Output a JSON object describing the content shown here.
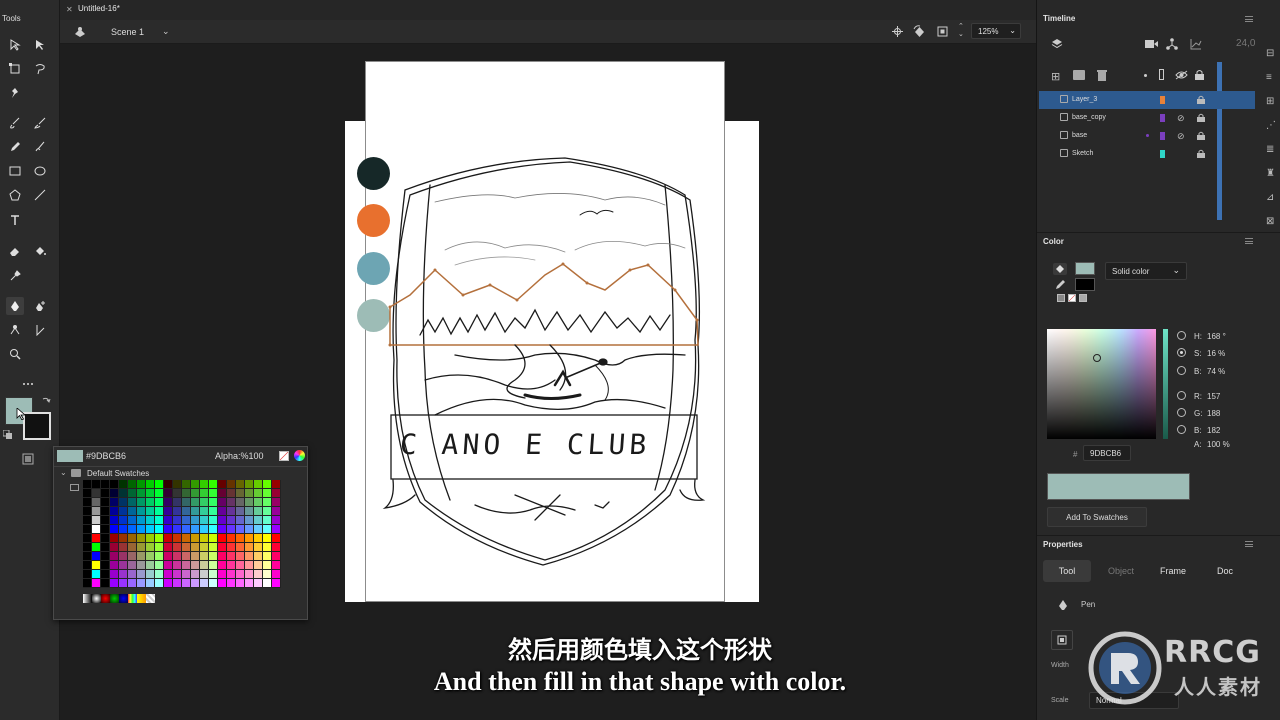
{
  "tools_panel": {
    "title": "Tools"
  },
  "document": {
    "tab_title": "Untitled-16*",
    "scene": "Scene 1",
    "zoom": "125%"
  },
  "palette_swatches": [
    "#162828",
    "#E8702E",
    "#6DA5B3",
    "#9DBCB6"
  ],
  "canvas_text": "C ANO E CLUB",
  "swatch_popup": {
    "hex": "#9DBCB6",
    "alpha": "Alpha:%100",
    "folder": "Default Swatches"
  },
  "timeline": {
    "title": "Timeline",
    "frame_number": "24,0",
    "layers": [
      {
        "name": "Layer_3",
        "color": "#E8823A",
        "selected": true
      },
      {
        "name": "base_copy",
        "color": "#7B3FBF",
        "selected": false
      },
      {
        "name": "base",
        "color": "#7B3FBF",
        "selected": false
      },
      {
        "name": "Sketch",
        "color": "#2FD6C8",
        "selected": false
      }
    ]
  },
  "color_panel": {
    "title": "Color",
    "fill_type": "Solid color",
    "fill_color": "#9DBCB6",
    "stroke_color": "#000000",
    "h_label": "H:",
    "h_value": "168 °",
    "s_label": "S:",
    "s_value": "16 %",
    "b_label": "B:",
    "b_value": "74 %",
    "r_label": "R:",
    "r_value": "157",
    "g_label": "G:",
    "g_value": "188",
    "b2_label": "B:",
    "b2_value": "182",
    "a_label": "A:",
    "a_value": "100 %",
    "hash": "#",
    "hex": "9DBCB6",
    "add_button": "Add To Swatches"
  },
  "properties": {
    "title": "Properties",
    "tabs": [
      "Tool",
      "Object",
      "Frame",
      "Doc"
    ],
    "active_tab": "Tool",
    "tool_name": "Pen",
    "width_label": "Width",
    "scale_label": "Scale",
    "scale_value": "Normal"
  },
  "subtitles": {
    "zh": "然后用颜色填入这个形状",
    "en": "And then fill in that shape with color."
  },
  "watermark": {
    "text": "RRCG",
    "sub": "人人素材"
  }
}
